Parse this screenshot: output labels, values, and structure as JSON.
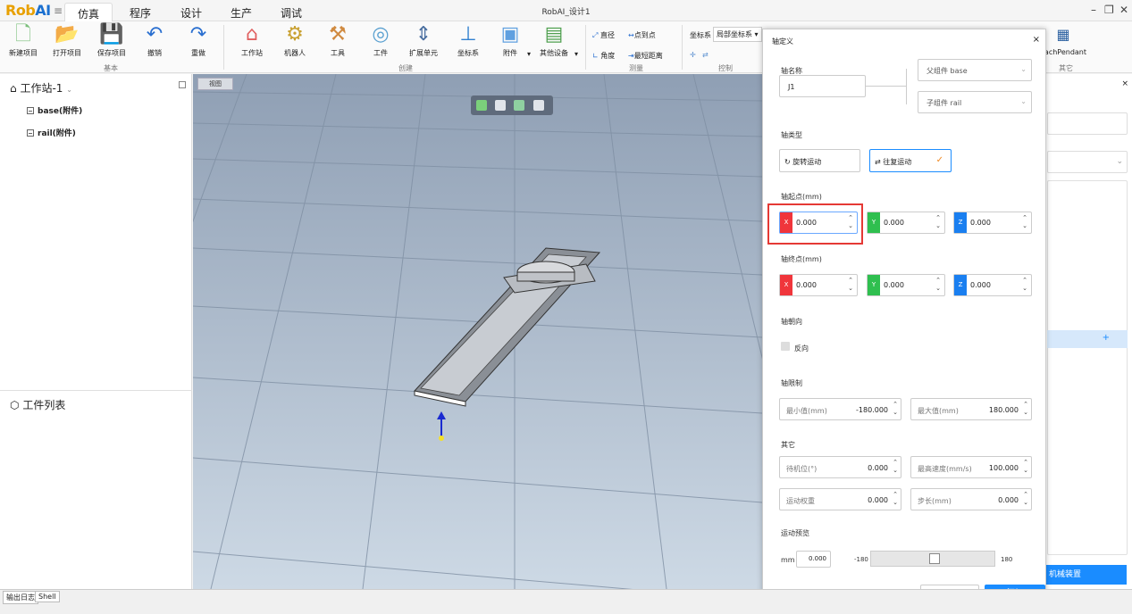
{
  "app": {
    "logo_a": "Rob",
    "logo_b": "AI",
    "window_title": "RobAI_设计1"
  },
  "menu_tabs": [
    "仿真",
    "程序",
    "设计",
    "生产",
    "调试"
  ],
  "ribbon": {
    "basic": {
      "new": "新建项目",
      "open": "打开项目",
      "save": "保存项目",
      "undo": "撤销",
      "redo": "重做",
      "group": "基本"
    },
    "create": {
      "workstation": "工作站",
      "robot": "机器人",
      "tool": "工具",
      "workpiece": "工件",
      "ext_unit": "扩展单元",
      "coord": "坐标系",
      "attach": "附件",
      "other": "其他设备",
      "group": "创建"
    },
    "measure": {
      "diameter": "直径",
      "p2p": "点到点",
      "angle": "角度",
      "min_dist": "最短距离",
      "group": "测量"
    },
    "control": {
      "coord_label": "坐标系",
      "coord_value": "局部坐标系",
      "group": "控制"
    },
    "other": {
      "teach": "eachPendant",
      "group": "其它"
    }
  },
  "left_panel": {
    "workstation": "工作站-1",
    "tree": [
      "base(附件)",
      "rail(附件)"
    ],
    "workpiece_title": "工件列表"
  },
  "viewport": {
    "tab": "视图"
  },
  "right_panel": {
    "mount_btn": "机械装置",
    "plus": "+"
  },
  "dialog": {
    "title": "轴定义",
    "close": "×",
    "axis_name_label": "轴名称",
    "axis_name": "J1",
    "parent": "父组件 base",
    "child": "子组件 rail",
    "axis_type_label": "轴类型",
    "rotary": "旋转运动",
    "linear": "往复运动",
    "start_label": "轴起点(mm)",
    "start": {
      "x": "0.000",
      "y": "0.000",
      "z": "0.000"
    },
    "end_label": "轴终点(mm)",
    "end": {
      "x": "0.000",
      "y": "0.000",
      "z": "0.000"
    },
    "x": "X",
    "y": "Y",
    "z": "Z",
    "direction_label": "轴朝向",
    "reverse": "反向",
    "limit_label": "轴限制",
    "min_label": "最小值(mm)",
    "min": "-180.000",
    "max_label": "最大值(mm)",
    "max": "180.000",
    "other_label": "其它",
    "standby_label": "待机位(°)",
    "standby": "0.000",
    "speed_label": "最高速度(mm/s)",
    "speed": "100.000",
    "weight_label": "运动权重",
    "weight": "0.000",
    "step_label": "步长(mm)",
    "step": "0.000",
    "preview_label": "运动预览",
    "unit": "mm",
    "preview_value": "0.000",
    "range_min": "-180",
    "range_max": "180",
    "cancel": "取消",
    "add": "添加"
  },
  "status_tabs": [
    "输出日志",
    "Shell"
  ],
  "colors": {
    "x": "#f0353b",
    "y": "#2fbf4f",
    "z": "#1a7ff0",
    "primary": "#1a8cff",
    "highlight": "#e53935"
  }
}
